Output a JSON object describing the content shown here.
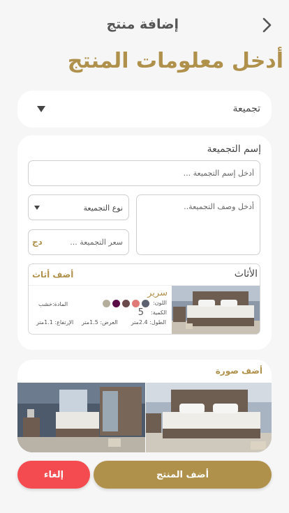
{
  "header": {
    "title": "إضافة منتج"
  },
  "heading": "أدخل معلومات المنتج",
  "collection_select": {
    "label": "تجميعة"
  },
  "form": {
    "name_label": "إسم التجميعة",
    "name_placeholder": "أدخل إسم التجميعة ...",
    "description_placeholder": "أدخل وصف التجميعة..",
    "type_label": "نوع التجميعة",
    "price_placeholder": "سعر التجميعة ...",
    "currency": "دج"
  },
  "furniture": {
    "title": "الأثاث",
    "add_label": "أضف أثاث",
    "items": [
      {
        "name": "سرير",
        "color_label": "اللون:",
        "colors": [
          "#5d6271",
          "#e07a78",
          "#6b4a4c",
          "#5b0d47",
          "#b6ae9c"
        ],
        "quantity_label": "الكمية:",
        "quantity": "5",
        "material": "المادة:خشب",
        "length": "الطول: 2.4متر",
        "width": "العرض: 1.5متر",
        "height": "الإرتفاع: 1.1متر"
      }
    ]
  },
  "images": {
    "add_label": "أضف صورة"
  },
  "actions": {
    "add_product": "أضف المنتج",
    "cancel": "إلغاء"
  },
  "colors": {
    "accent": "#b0914c",
    "danger": "#f34b4f"
  }
}
